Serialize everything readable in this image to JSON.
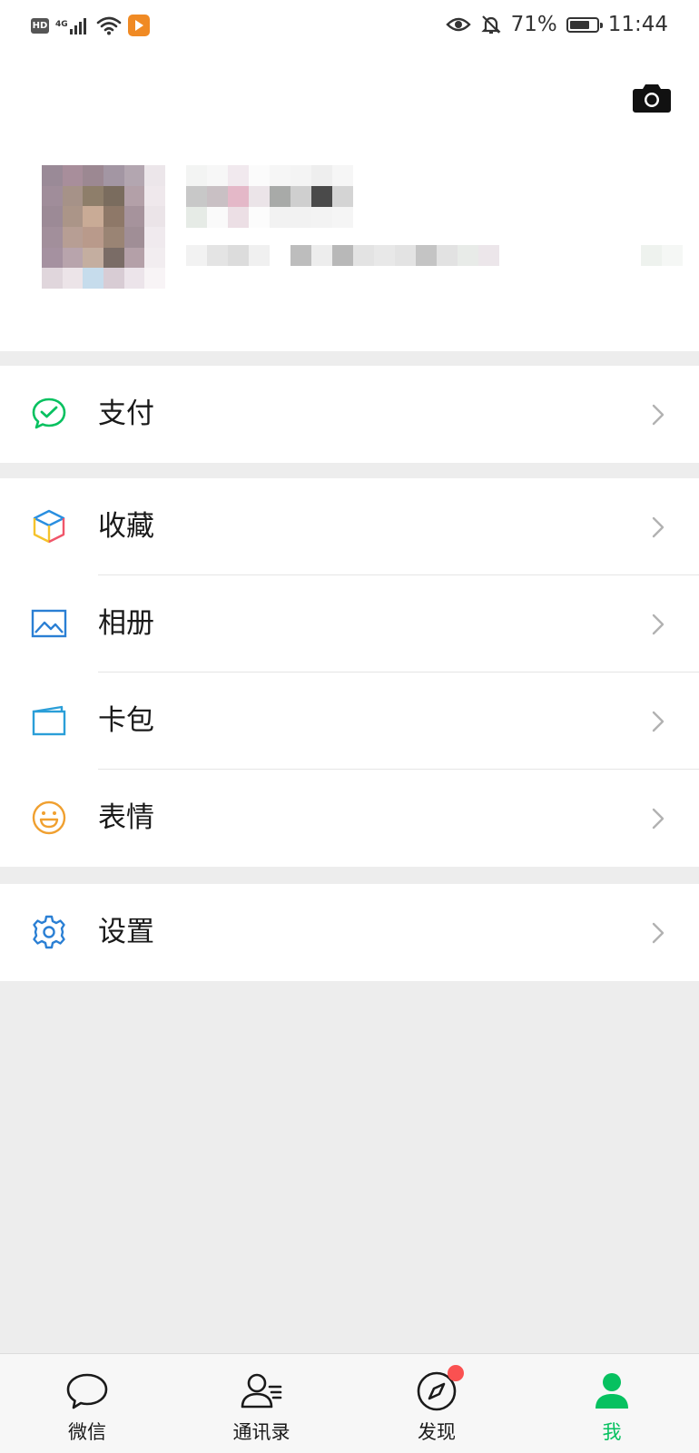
{
  "status_bar": {
    "hd": "HD",
    "network": "4G",
    "battery_percent": "71%",
    "time": "11:44"
  },
  "profile": {
    "camera_icon": "camera-icon",
    "avatar_state": "pixelated",
    "nickname": "",
    "wechat_id": ""
  },
  "menu": {
    "pay": {
      "label": "支付",
      "icon": "wechat-pay-icon",
      "color": "#07c160"
    },
    "favorites": {
      "label": "收藏",
      "icon": "cube-icon"
    },
    "album": {
      "label": "相册",
      "icon": "album-icon",
      "color": "#2a7fd4"
    },
    "cards": {
      "label": "卡包",
      "icon": "card-wallet-icon",
      "color": "#2a9ed8"
    },
    "stickers": {
      "label": "表情",
      "icon": "smiley-icon",
      "color": "#f0a030"
    },
    "settings": {
      "label": "设置",
      "icon": "gear-icon",
      "color": "#2a7fd4"
    }
  },
  "tabs": [
    {
      "label": "微信",
      "icon": "chat-bubble-icon"
    },
    {
      "label": "通讯录",
      "icon": "contacts-icon"
    },
    {
      "label": "发现",
      "icon": "compass-icon",
      "badge": "dot"
    },
    {
      "label": "我",
      "icon": "me-person-icon",
      "active": true
    }
  ],
  "colors": {
    "accent": "#07c160",
    "badge": "#fa5151",
    "background": "#ededed"
  }
}
